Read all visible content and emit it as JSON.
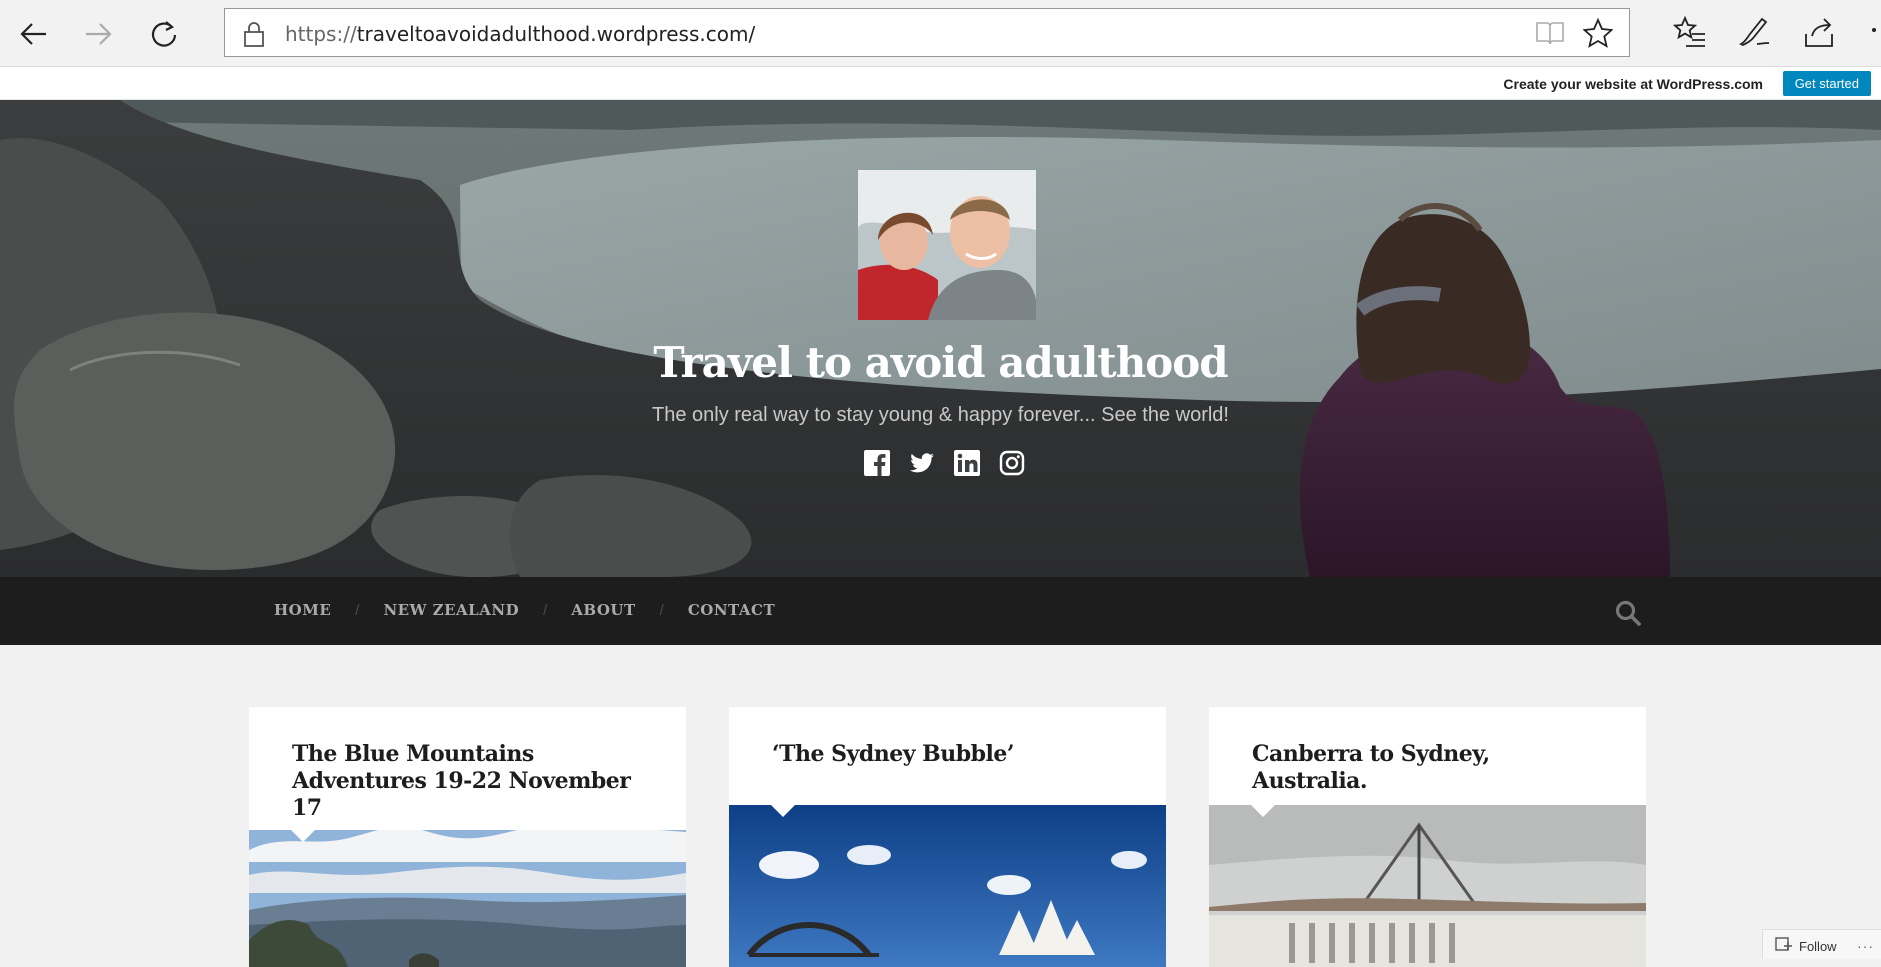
{
  "browser": {
    "url_proto": "https://",
    "url_host": "traveltoavoidadulthood.wordpress.com/"
  },
  "wpbar": {
    "create_text": "Create your website at WordPress.com",
    "get_started": "Get started"
  },
  "site": {
    "title": "Travel to avoid adulthood",
    "tagline": "The only real way to stay young & happy forever... See the world!"
  },
  "nav": {
    "items": [
      "HOME",
      "NEW ZEALAND",
      "ABOUT",
      "CONTACT"
    ]
  },
  "posts": [
    {
      "title": "The Blue Mountains Adventures 19-22 November 17"
    },
    {
      "title": "‘The Sydney Bubble’"
    },
    {
      "title": "Canberra to Sydney, Australia."
    }
  ],
  "follow": {
    "label": "Follow",
    "more": "···"
  },
  "colors": {
    "accent": "#0087be",
    "nav_bg": "#1d1d1d",
    "page_bg": "#f1f1f1"
  },
  "icons": [
    "back-icon",
    "forward-icon",
    "refresh-icon",
    "lock-icon",
    "reading-view-icon",
    "favorite-star-icon",
    "favorites-list-icon",
    "pen-icon",
    "share-icon",
    "facebook-icon",
    "twitter-icon",
    "linkedin-icon",
    "instagram-icon",
    "search-icon"
  ]
}
